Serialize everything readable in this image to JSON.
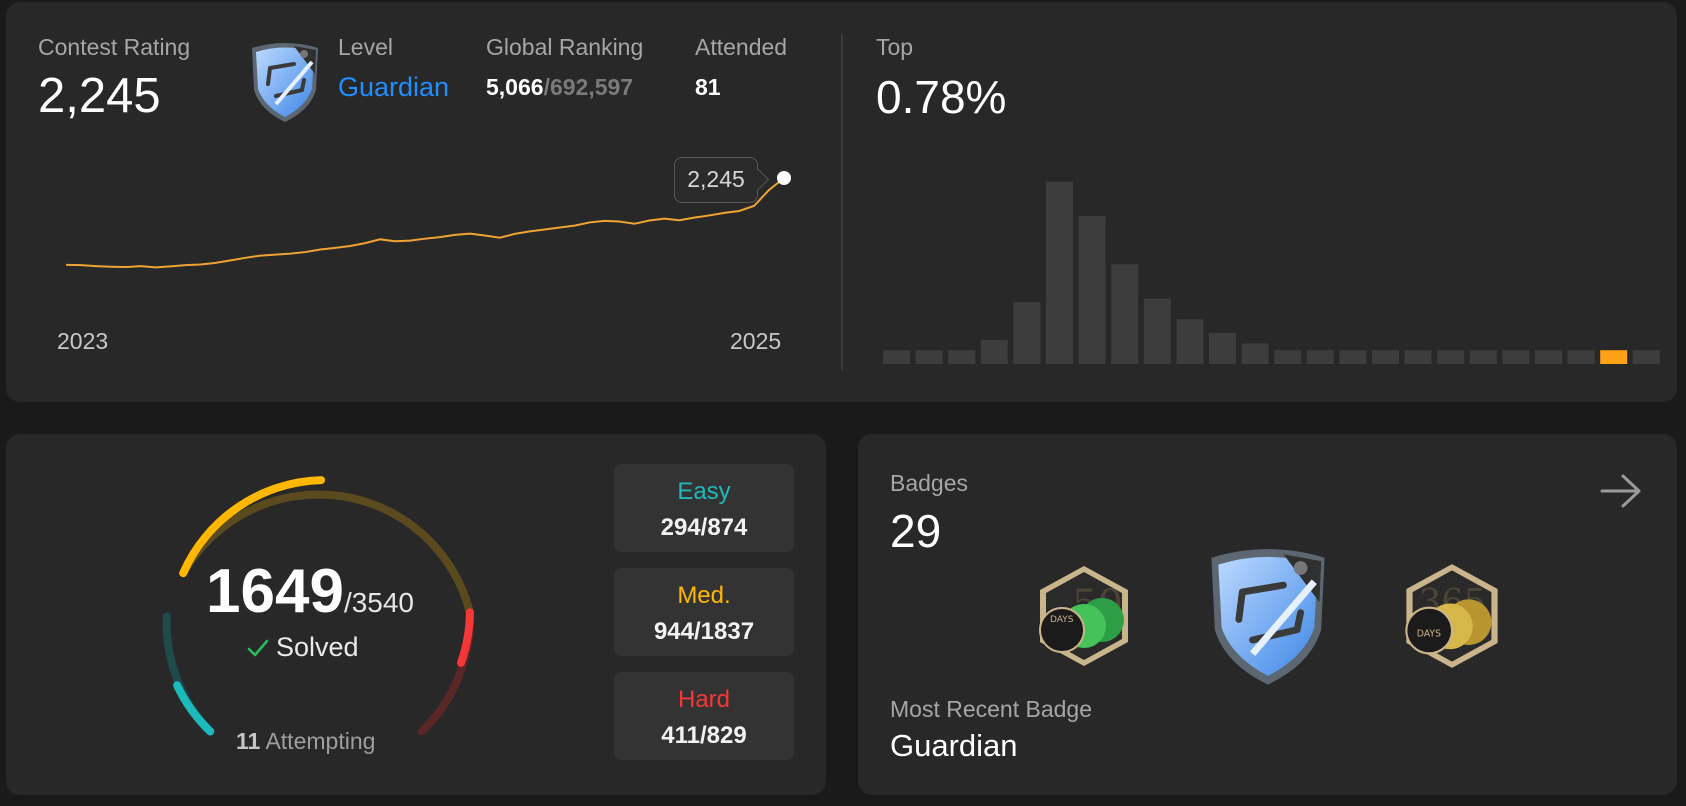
{
  "contest": {
    "rating_label": "Contest Rating",
    "rating": "2,245",
    "level_label": "Level",
    "level": "Guardian",
    "ranking_label": "Global Ranking",
    "ranking": "5,066",
    "ranking_total": "/692,597",
    "attended_label": "Attended",
    "attended": "81",
    "top_label": "Top",
    "top": "0.78%",
    "tooltip": "2,245",
    "x_start": "2023",
    "x_end": "2025"
  },
  "chart_data": [
    {
      "type": "line",
      "series": [
        {
          "values": [
            1700,
            1698,
            1692,
            1688,
            1686,
            1692,
            1684,
            1690,
            1698,
            1702,
            1712,
            1728,
            1744,
            1758,
            1764,
            1770,
            1780,
            1796,
            1806,
            1818,
            1836,
            1860,
            1848,
            1852,
            1864,
            1874,
            1888,
            1896,
            1884,
            1870,
            1894,
            1910,
            1922,
            1934,
            1946,
            1966,
            1976,
            1972,
            1958,
            1978,
            1990,
            1980,
            1996,
            2010,
            2026,
            2038,
            2070,
            2170,
            2245
          ]
        }
      ],
      "x": [
        "2023",
        "2025"
      ],
      "color": "#f0a235"
    },
    {
      "type": "bar",
      "values": [
        4,
        4,
        4,
        7,
        18,
        53,
        43,
        29,
        19,
        13,
        9,
        6,
        4,
        4,
        4,
        4,
        4,
        4,
        4,
        4,
        4,
        4,
        4,
        4
      ],
      "highlight_index": 22,
      "highlight_color": "#ffa116",
      "bar_color": "#3d3d3d"
    }
  ],
  "solved": {
    "count": "1649",
    "total": "/3540",
    "check_icon": "check-icon",
    "label": "Solved",
    "attempting_count": "11",
    "attempting_label": "Attempting",
    "easy_label": "Easy",
    "easy": "294/874",
    "med_label": "Med.",
    "med": "944/1837",
    "hard_label": "Hard",
    "hard": "411/829",
    "colors": {
      "easy": "#1cbaba",
      "medium": "#ffb700",
      "hard": "#f63737"
    }
  },
  "badges": {
    "label": "Badges",
    "count": "29",
    "recent_label": "Most Recent Badge",
    "recent": "Guardian",
    "days_text": "DAYS"
  }
}
